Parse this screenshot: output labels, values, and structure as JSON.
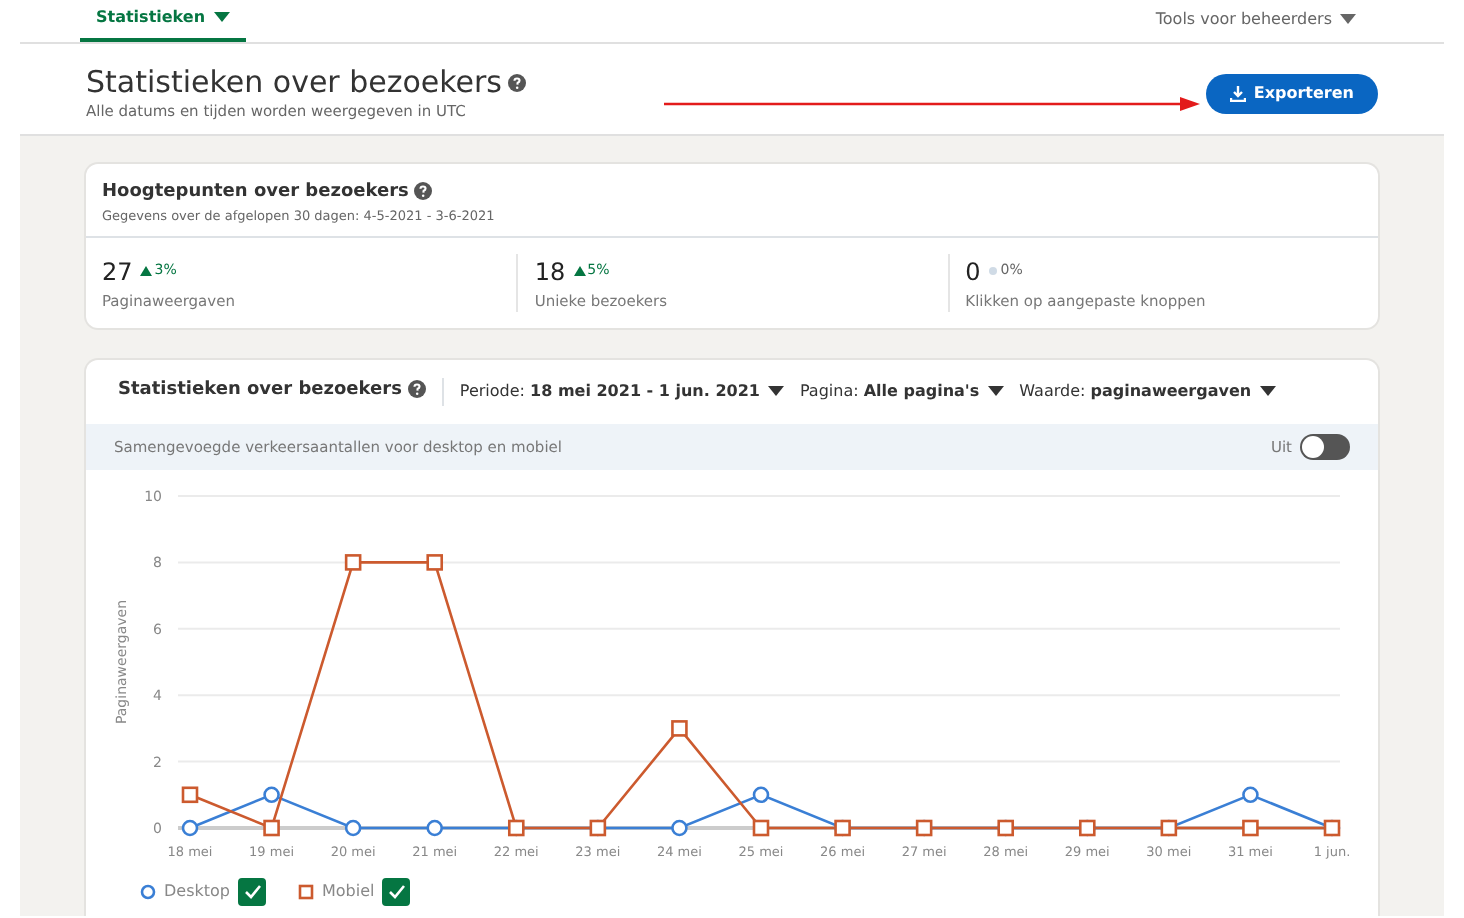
{
  "nav": {
    "tabs": [
      {
        "label": "Statistieken",
        "selected": true
      }
    ],
    "tools": "Tools voor beheerders"
  },
  "header": {
    "title": "Statistieken over bezoekers",
    "subtitle": "Alle datums en tijden worden weergegeven in UTC",
    "export_button": "Exporteren"
  },
  "highlights": {
    "title": "Hoogtepunten over bezoekers",
    "subtitle": "Gegevens over de afgelopen 30 dagen: 4-5-2021 - 3-6-2021",
    "stats": [
      {
        "value": "27",
        "change": "3%",
        "kind": "up",
        "label": "Paginaweergaven"
      },
      {
        "value": "18",
        "change": "5%",
        "kind": "up",
        "label": "Unieke bezoekers"
      },
      {
        "value": "0",
        "change": "0%",
        "kind": "flat",
        "label": "Klikken op aangepaste knoppen"
      }
    ]
  },
  "visitors": {
    "title": "Statistieken over bezoekers",
    "filters": [
      {
        "label": "Periode:",
        "value": "18 mei 2021 - 1 jun. 2021"
      },
      {
        "label": "Pagina:",
        "value": "Alle pagina's"
      },
      {
        "label": "Waarde:",
        "value": "paginaweergaven"
      }
    ],
    "banner": "Samengevoegde verkeersaantallen voor desktop en mobiel",
    "toggle": {
      "label": "Uit",
      "on": false
    },
    "chart_data": {
      "type": "line",
      "ylabel": "Paginaweergaven",
      "categories": [
        "18 mei",
        "19 mei",
        "20 mei",
        "21 mei",
        "22 mei",
        "23 mei",
        "24 mei",
        "25 mei",
        "26 mei",
        "27 mei",
        "28 mei",
        "29 mei",
        "30 mei",
        "31 mei",
        "1 jun."
      ],
      "ylim": [
        0,
        10
      ],
      "yticks": [
        0,
        2,
        4,
        6,
        8,
        10
      ],
      "grid": true,
      "series": [
        {
          "name": "Desktop",
          "color": "#3a7fd5",
          "marker": "circle",
          "values": [
            0,
            1,
            0,
            0,
            0,
            0,
            0,
            1,
            0,
            0,
            0,
            0,
            0,
            1,
            0
          ]
        },
        {
          "name": "Mobiel",
          "color": "#cc5a2e",
          "marker": "square",
          "values": [
            1,
            0,
            8,
            8,
            0,
            0,
            3,
            0,
            0,
            0,
            0,
            0,
            0,
            0,
            0
          ]
        }
      ]
    },
    "legend": [
      {
        "checked": true
      },
      {
        "checked": true
      }
    ]
  }
}
